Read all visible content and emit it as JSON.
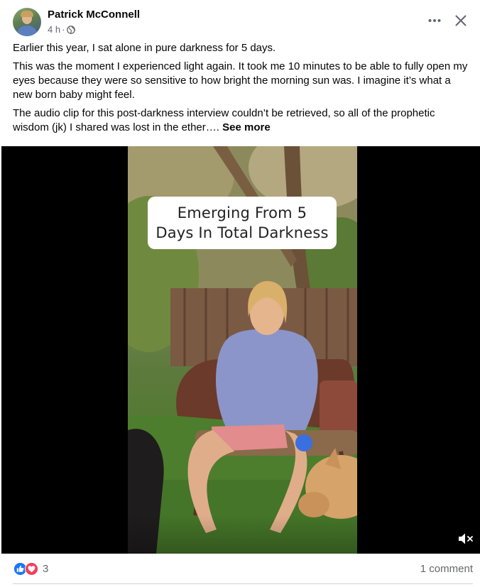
{
  "author": {
    "name": "Patrick McConnell",
    "time": "4 h",
    "separator": "·"
  },
  "post": {
    "paragraphs": [
      "Earlier this year, I sat alone in pure darkness for 5 days.",
      "This was the moment I experienced light again. It took me 10 minutes to be able to fully open my eyes because they were so sensitive to how bright the morning sun was. I imagine it’s what a new born baby might feel.",
      "The audio clip for this post-darkness interview couldn’t be retrieved, so all of the prophetic wisdom (jk) I shared was lost in the ether…."
    ],
    "see_more": "See more"
  },
  "video": {
    "title_lines": [
      "Emerging From 5",
      "Days In Total Darkness"
    ],
    "muted": true
  },
  "footer": {
    "reaction_count": "3",
    "comment_count": "1 comment"
  },
  "icons": {
    "like": "like-icon",
    "love": "love-icon",
    "more": "more-icon",
    "close": "close-icon",
    "audience": "globe-icon",
    "mute": "mute-icon"
  },
  "colors": {
    "like_blue": "#1877f2",
    "love_red": "#f33e58",
    "secondary_text": "#65676b"
  }
}
